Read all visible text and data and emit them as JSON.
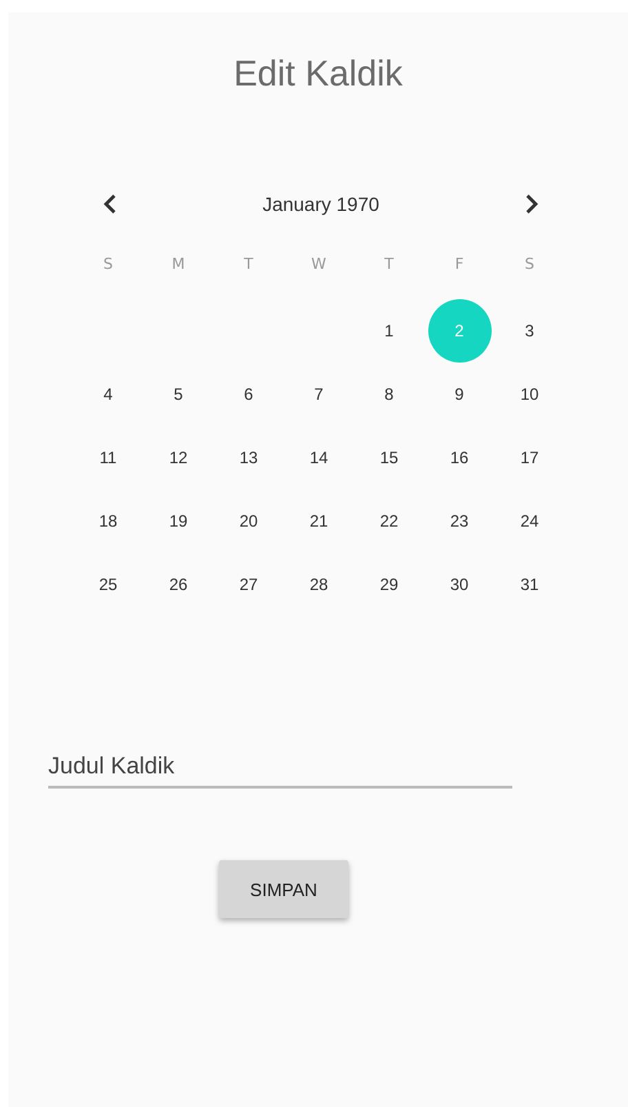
{
  "title": "Edit Kaldik",
  "calendar": {
    "month": "January 1970",
    "weekdays": [
      "S",
      "M",
      "T",
      "W",
      "T",
      "F",
      "S"
    ],
    "weeks": [
      [
        {
          "day": "1",
          "selected": false
        },
        {
          "day": "2",
          "selected": true
        },
        {
          "day": "3",
          "selected": false
        }
      ],
      [
        {
          "day": "4",
          "selected": false
        },
        {
          "day": "5",
          "selected": false
        },
        {
          "day": "6",
          "selected": false
        },
        {
          "day": "7",
          "selected": false
        },
        {
          "day": "8",
          "selected": false
        },
        {
          "day": "9",
          "selected": false
        },
        {
          "day": "10",
          "selected": false
        }
      ],
      [
        {
          "day": "11",
          "selected": false
        },
        {
          "day": "12",
          "selected": false
        },
        {
          "day": "13",
          "selected": false
        },
        {
          "day": "14",
          "selected": false
        },
        {
          "day": "15",
          "selected": false
        },
        {
          "day": "16",
          "selected": false
        },
        {
          "day": "17",
          "selected": false
        }
      ],
      [
        {
          "day": "18",
          "selected": false
        },
        {
          "day": "19",
          "selected": false
        },
        {
          "day": "20",
          "selected": false
        },
        {
          "day": "21",
          "selected": false
        },
        {
          "day": "22",
          "selected": false
        },
        {
          "day": "23",
          "selected": false
        },
        {
          "day": "24",
          "selected": false
        }
      ],
      [
        {
          "day": "25",
          "selected": false
        },
        {
          "day": "26",
          "selected": false
        },
        {
          "day": "27",
          "selected": false
        },
        {
          "day": "28",
          "selected": false
        },
        {
          "day": "29",
          "selected": false
        },
        {
          "day": "30",
          "selected": false
        },
        {
          "day": "31",
          "selected": false
        }
      ]
    ]
  },
  "title_field": {
    "placeholder": "Judul Kaldik"
  },
  "save_button": "SIMPAN"
}
